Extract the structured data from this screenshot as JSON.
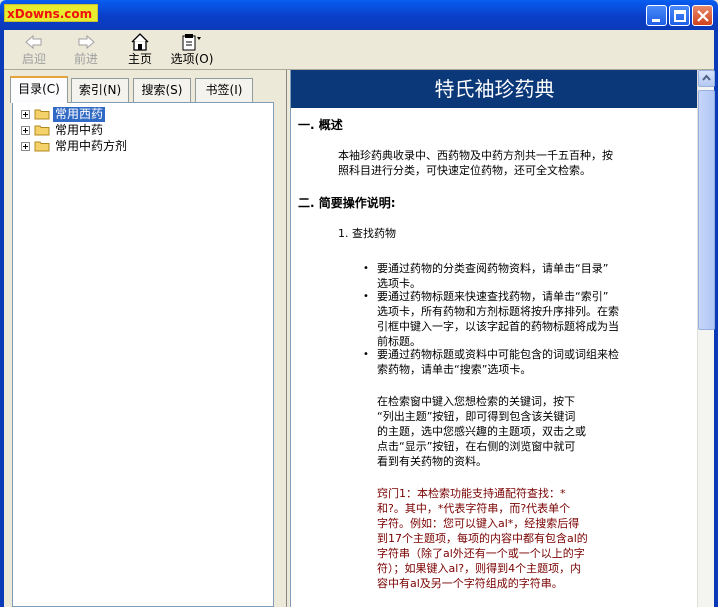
{
  "window": {
    "logo": "xDowns.com",
    "title": ""
  },
  "toolbar": {
    "back": "启迎",
    "forward": "前进",
    "home": "主页",
    "options": "选项(O)"
  },
  "tabs": [
    "目录(C)",
    "索引(N)",
    "搜索(S)",
    "书签(I)"
  ],
  "tree": [
    "常用西药",
    "常用中药",
    "常用中药方剂"
  ],
  "content": {
    "banner": "特氏袖珍药典",
    "s1_title": "一. 概述",
    "s1_p1": "本袖珍药典收录中、西药物及中药方剂共一千五百种，按",
    "s1_p2": "照科目进行分类，可快速定位药物，还可全文检索。",
    "s2_title": "二. 简要操作说明:",
    "s2_item": "1. 查找药物",
    "b1_l1": "要通过药物的分类查阅药物资料，请单击“目录”",
    "b1_l2": "选项卡。",
    "b2_l1": "要通过药物标题来快速查找药物，请单击“索引”",
    "b2_l2": "选项卡，所有药物和方剂标题将按升序排列。在索",
    "b2_l3": "引框中键入一字，以该字起首的药物标题将成为当",
    "b2_l4": "前标题。",
    "b3_l1": "要通过药物标题或资料中可能包含的词或词组来检",
    "b3_l2": "索药物，请单击“搜索”选项卡。",
    "p_l1": "在检索窗中键入您想检索的关键词，按下",
    "p_l2": "“列出主题”按钮，即可得到包含该关键词",
    "p_l3": "的主题，选中您感兴趣的主题项，双击之或",
    "p_l4": "点击“显示”按钮，在右侧的浏览窗中就可",
    "p_l5": "看到有关药物的资料。",
    "r_l1": "窍门1：本检索功能支持通配符查找：*",
    "r_l2": "和?。其中，*代表字符串，而?代表单个",
    "r_l3": "字符。例如：您可以键入al*，经搜索后得",
    "r_l4": "到17个主题项，每项的内容中都有包含al的",
    "r_l5": "字符串（除了al外还有一个或一个以上的字",
    "r_l6": "符）；如果键入al?，则得到4个主题项，内",
    "r_l7": "容中有al及另一个字符组成的字符串。"
  },
  "colors": {
    "titlebar": "#0a3fc9",
    "banner": "#0b3878",
    "selection": "#316ac5",
    "tip_text": "#7a0000"
  }
}
